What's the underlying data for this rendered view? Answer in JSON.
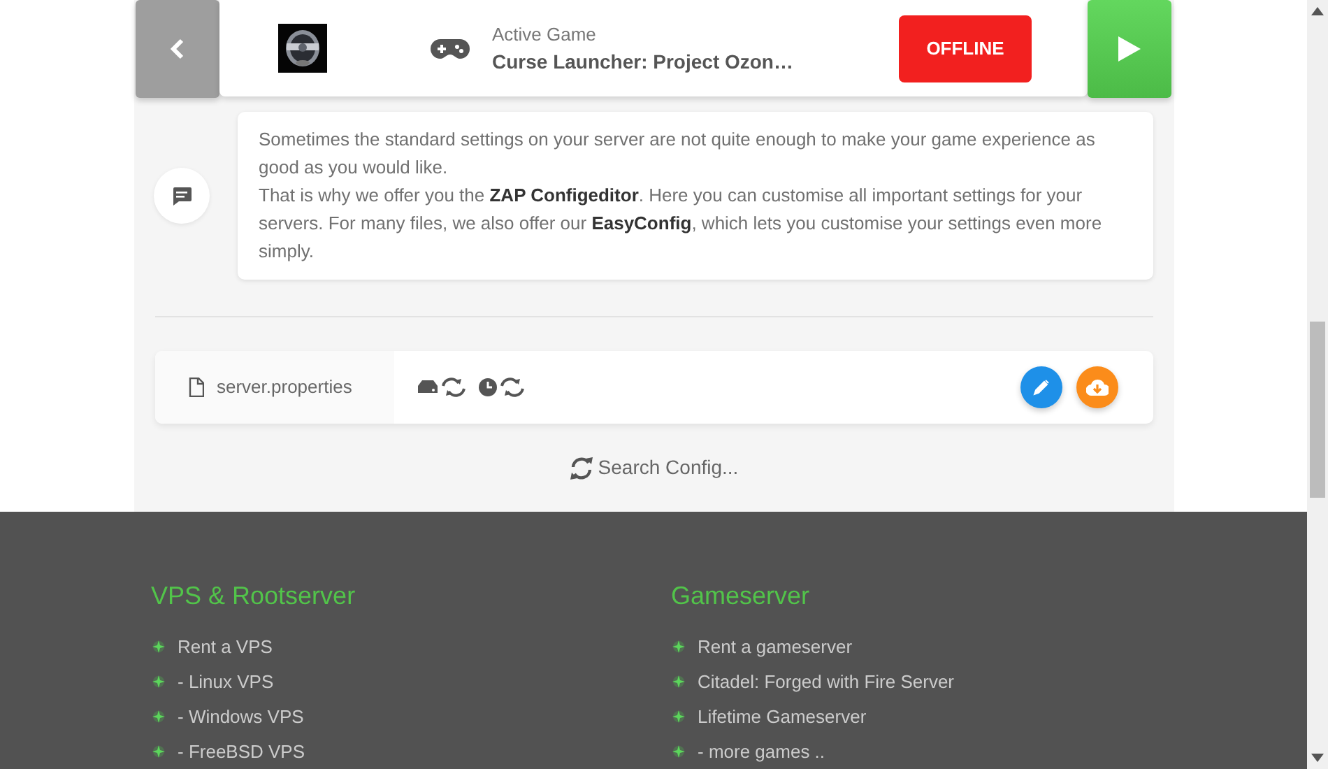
{
  "top_bar": {
    "active_game": {
      "label": "Active Game",
      "name": "Curse Launcher: Project Ozon…"
    },
    "status": {
      "label": "OFFLINE",
      "online": false
    }
  },
  "info_message": {
    "paragraphs": [
      "Sometimes the standard settings on your server are not quite enough to make your game experience as good as you would like.",
      "That is why we offer you the **ZAP Configeditor**. Here you can customise all important settings for your servers. For many files, we also offer our **EasyConfig**, which lets you customise your settings even more simply."
    ]
  },
  "config_files": [
    {
      "name": "server.properties"
    }
  ],
  "search_link": "Search Config...",
  "footer": {
    "columns": [
      {
        "title": "VPS & Rootserver",
        "links": [
          "Rent a VPS",
          "- Linux VPS",
          "- Windows VPS",
          "- FreeBSD VPS"
        ]
      },
      {
        "title": "Gameserver",
        "links": [
          "Rent a gameserver",
          "Citadel: Forged with Fire Server",
          "Lifetime Gameserver",
          "- more games .."
        ]
      }
    ]
  }
}
